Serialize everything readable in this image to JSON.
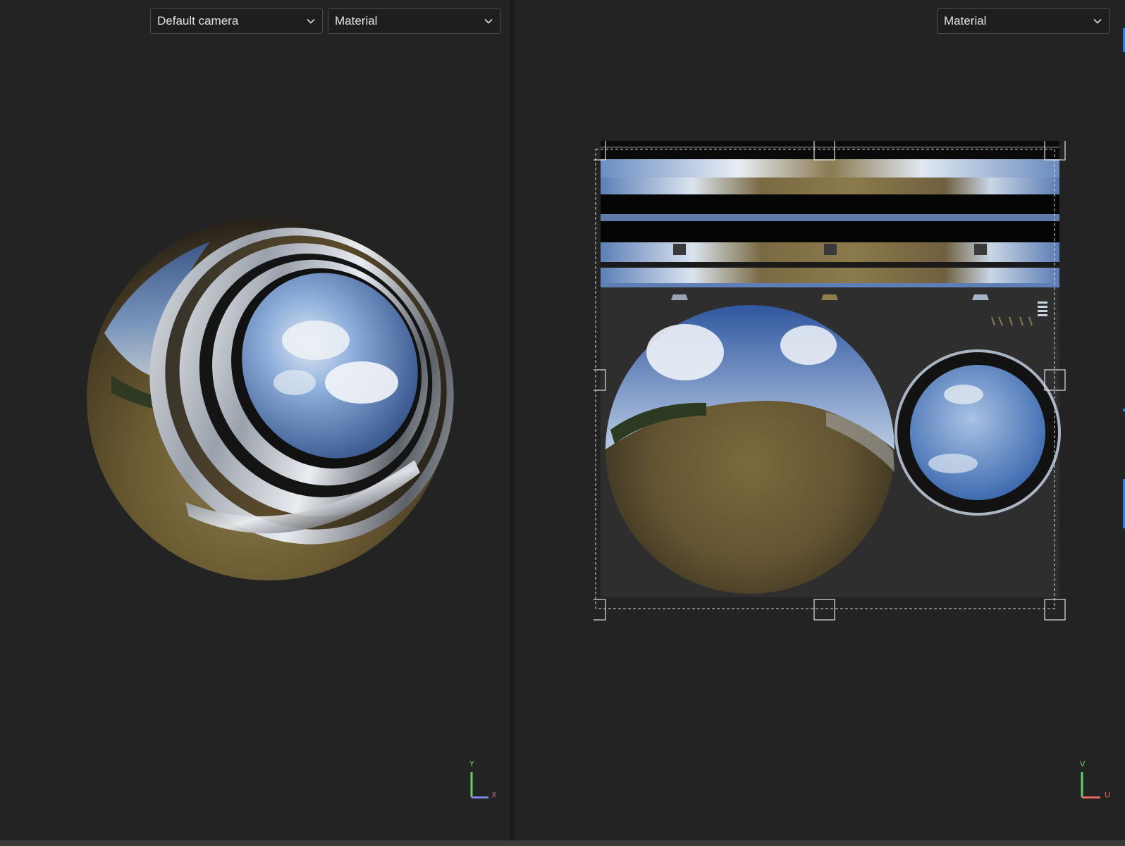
{
  "viewport_3d": {
    "camera_dropdown": {
      "selected": "Default camera",
      "icon": "chevron-down-icon"
    },
    "mode_dropdown": {
      "selected": "Material",
      "icon": "chevron-down-icon"
    },
    "axis_gizmo": {
      "vertical_label": "Y",
      "horizontal_label": "X"
    }
  },
  "viewport_2d": {
    "mode_dropdown": {
      "selected": "Material",
      "icon": "chevron-down-icon"
    },
    "axis_gizmo": {
      "vertical_label": "V",
      "horizontal_label": "U"
    }
  },
  "colors": {
    "background": "#232323",
    "dropdown_bg": "#1e1e1e",
    "dropdown_border": "#4a4a4a",
    "text": "#e2e2e2",
    "axis_vertical": "#5fd06a",
    "axis_horizontal_3d": "#7f86e8",
    "axis_horizontal_uv": "#e86a6a",
    "accent": "#3a7bd5"
  }
}
